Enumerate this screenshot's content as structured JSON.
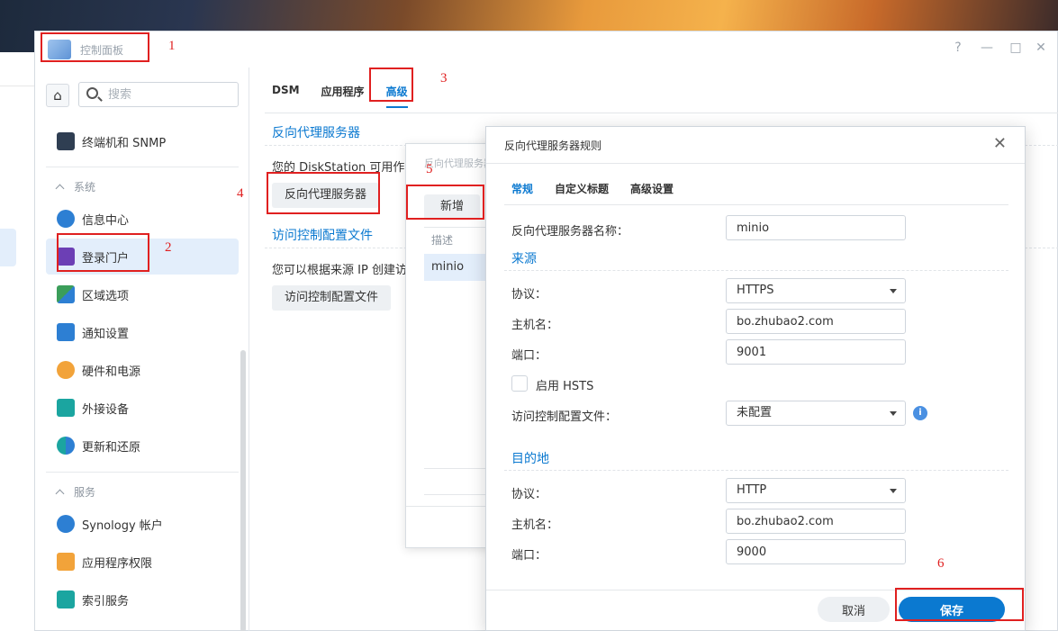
{
  "window": {
    "title": "控制面板",
    "controls": {
      "help": "?",
      "minimize": "—",
      "maximize": "□",
      "close": "✕"
    }
  },
  "sidebar": {
    "search_placeholder": "搜索",
    "items": [
      {
        "label": "终端机和 SNMP",
        "icon": "terminal-icon"
      },
      {
        "label": "信息中心",
        "icon": "info-icon"
      },
      {
        "label": "登录门户",
        "icon": "login-portal-icon",
        "active": true
      },
      {
        "label": "区域选项",
        "icon": "region-icon"
      },
      {
        "label": "通知设置",
        "icon": "notification-icon"
      },
      {
        "label": "硬件和电源",
        "icon": "hardware-power-icon"
      },
      {
        "label": "外接设备",
        "icon": "external-device-icon"
      },
      {
        "label": "更新和还原",
        "icon": "update-restore-icon"
      },
      {
        "label": "Synology 帐户",
        "icon": "synology-account-icon"
      },
      {
        "label": "应用程序权限",
        "icon": "app-privileges-icon"
      },
      {
        "label": "索引服务",
        "icon": "indexing-service-icon"
      }
    ],
    "sections": {
      "system": "系统",
      "services": "服务"
    }
  },
  "content": {
    "tabs": [
      "DSM",
      "应用程序",
      "高级"
    ],
    "active_tab": "高级",
    "section1_title": "反向代理服务器",
    "section1_text": "您的 DiskStation 可用作",
    "section1_button": "反向代理服务器",
    "section2_title": "访问控制配置文件",
    "section2_text": "您可以根据来源 IP 创建访",
    "section2_button": "访问控制配置文件"
  },
  "mid_dialog": {
    "title": "反向代理服务器",
    "add_button": "新增",
    "column_header": "描述",
    "rows": [
      "minio"
    ]
  },
  "dialog": {
    "title": "反向代理服务器规则",
    "tabs": [
      "常规",
      "自定义标题",
      "高级设置"
    ],
    "active_tab": "常规",
    "name_label": "反向代理服务器名称：",
    "name_value": "minio",
    "source_title": "来源",
    "source": {
      "protocol_label": "协议：",
      "protocol_value": "HTTPS",
      "host_label": "主机名：",
      "host_value": "bo.zhubao2.com",
      "port_label": "端口：",
      "port_value": "9001",
      "hsts_label": "启用 HSTS",
      "acl_label": "访问控制配置文件：",
      "acl_value": "未配置"
    },
    "dest_title": "目的地",
    "destination": {
      "protocol_label": "协议：",
      "protocol_value": "HTTP",
      "host_label": "主机名：",
      "host_value": "bo.zhubao2.com",
      "port_label": "端口：",
      "port_value": "9000"
    },
    "cancel_label": "取消",
    "save_label": "保存"
  },
  "annotations": [
    "1",
    "2",
    "3",
    "4",
    "5",
    "6"
  ],
  "colors": {
    "accent": "#0b79d0",
    "annotation": "#e02020",
    "selected_bg": "#e3eefb"
  }
}
